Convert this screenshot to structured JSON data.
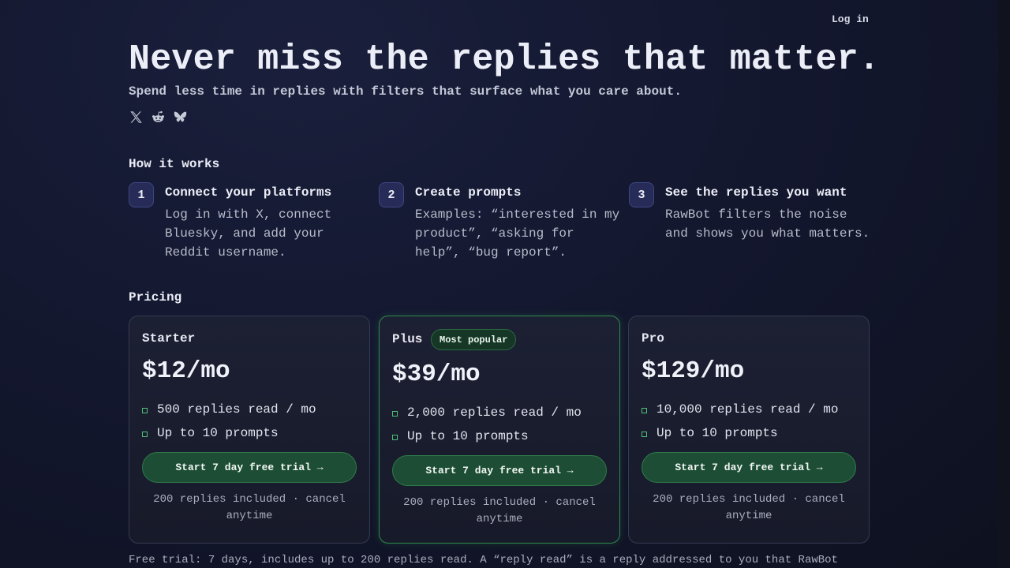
{
  "header": {
    "login_label": "Log in"
  },
  "hero": {
    "title": "Never miss the replies that matter.",
    "subtitle": "Spend less time in replies with filters that surface what you care about.",
    "socials": [
      "x-icon",
      "reddit-icon",
      "bluesky-icon"
    ]
  },
  "how_it_works": {
    "title": "How it works",
    "steps": [
      {
        "number": "1",
        "title": "Connect your platforms",
        "body": "Log in with X, connect Bluesky, and add your Reddit username."
      },
      {
        "number": "2",
        "title": "Create prompts",
        "body": "Examples: “interested in my product”, “asking for help”, “bug report”."
      },
      {
        "number": "3",
        "title": "See the replies you want",
        "body": "RawBot filters the noise and shows you what matters."
      }
    ]
  },
  "pricing": {
    "title": "Pricing",
    "plans": [
      {
        "name": "Starter",
        "price": "$12/mo",
        "features": [
          "500 replies read / mo",
          "Up to 10 prompts"
        ],
        "cta": "Start 7 day free trial →",
        "note": "200 replies included · cancel anytime"
      },
      {
        "name": "Plus",
        "badge": "Most popular",
        "price": "$39/mo",
        "features": [
          "2,000 replies read / mo",
          "Up to 10 prompts"
        ],
        "cta": "Start 7 day free trial →",
        "note": "200 replies included · cancel anytime"
      },
      {
        "name": "Pro",
        "price": "$129/mo",
        "features": [
          "10,000 replies read / mo",
          "Up to 10 prompts"
        ],
        "cta": "Start 7 day free trial →",
        "note": "200 replies included · cancel anytime"
      }
    ],
    "footnote": "Free trial: 7 days, includes up to 200 replies read. A “reply read” is a reply addressed to you that RawBot"
  },
  "colors": {
    "background": "#141830",
    "accent_green": "#1d4e35",
    "popular_border": "#2f8a4d",
    "step_badge": "#262c57"
  }
}
